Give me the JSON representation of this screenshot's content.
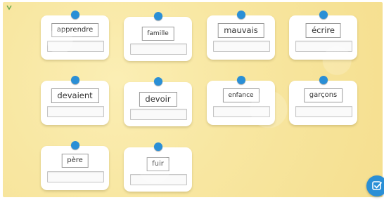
{
  "cards": [
    {
      "word": "apprendre",
      "answer": ""
    },
    {
      "word": "famille",
      "answer": ""
    },
    {
      "word": "mauvais",
      "answer": ""
    },
    {
      "word": "écrire",
      "answer": ""
    },
    {
      "word": "devaient",
      "answer": ""
    },
    {
      "word": "devoir",
      "answer": ""
    },
    {
      "word": "enfance",
      "answer": ""
    },
    {
      "word": "garçons",
      "answer": ""
    },
    {
      "word": "père",
      "answer": ""
    },
    {
      "word": "fuir",
      "answer": ""
    }
  ],
  "colors": {
    "pin": "#2a8fd6",
    "board": "#f8e7a2",
    "check_button": "#2a8fd6"
  },
  "icons": {
    "check_button": "check-square-icon",
    "pin": "pin-icon",
    "logo": "app-logo-icon"
  }
}
